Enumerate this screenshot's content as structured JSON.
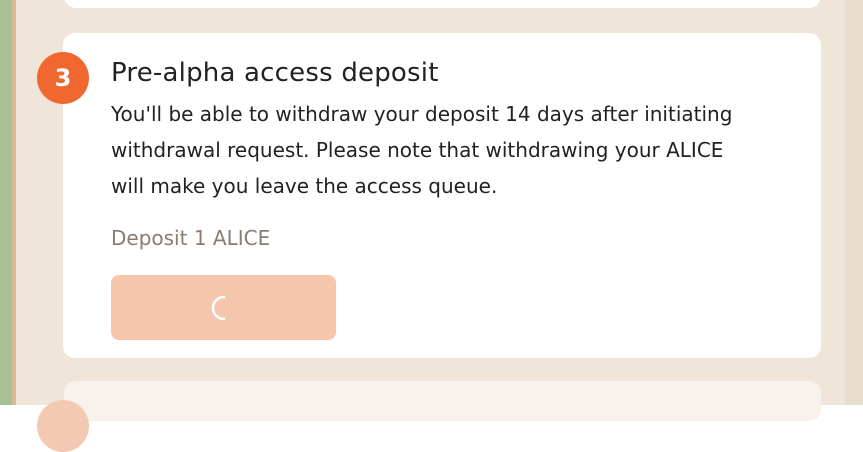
{
  "step": {
    "number": "3",
    "title": "Pre-alpha access deposit",
    "description": "You'll be able to withdraw your deposit 14 days after initiating withdrawal request. Please note that withdrawing your ALICE will make you leave the access queue.",
    "deposit_label": "Deposit 1 ALICE",
    "button_state": "loading"
  },
  "icons": {
    "spinner": "loading-spinner-icon"
  },
  "colors": {
    "accent": "#f0682f",
    "button_disabled": "#f6c5ad",
    "text_primary": "#222222",
    "text_muted": "#8b7b72",
    "background": "#efe5d9"
  }
}
